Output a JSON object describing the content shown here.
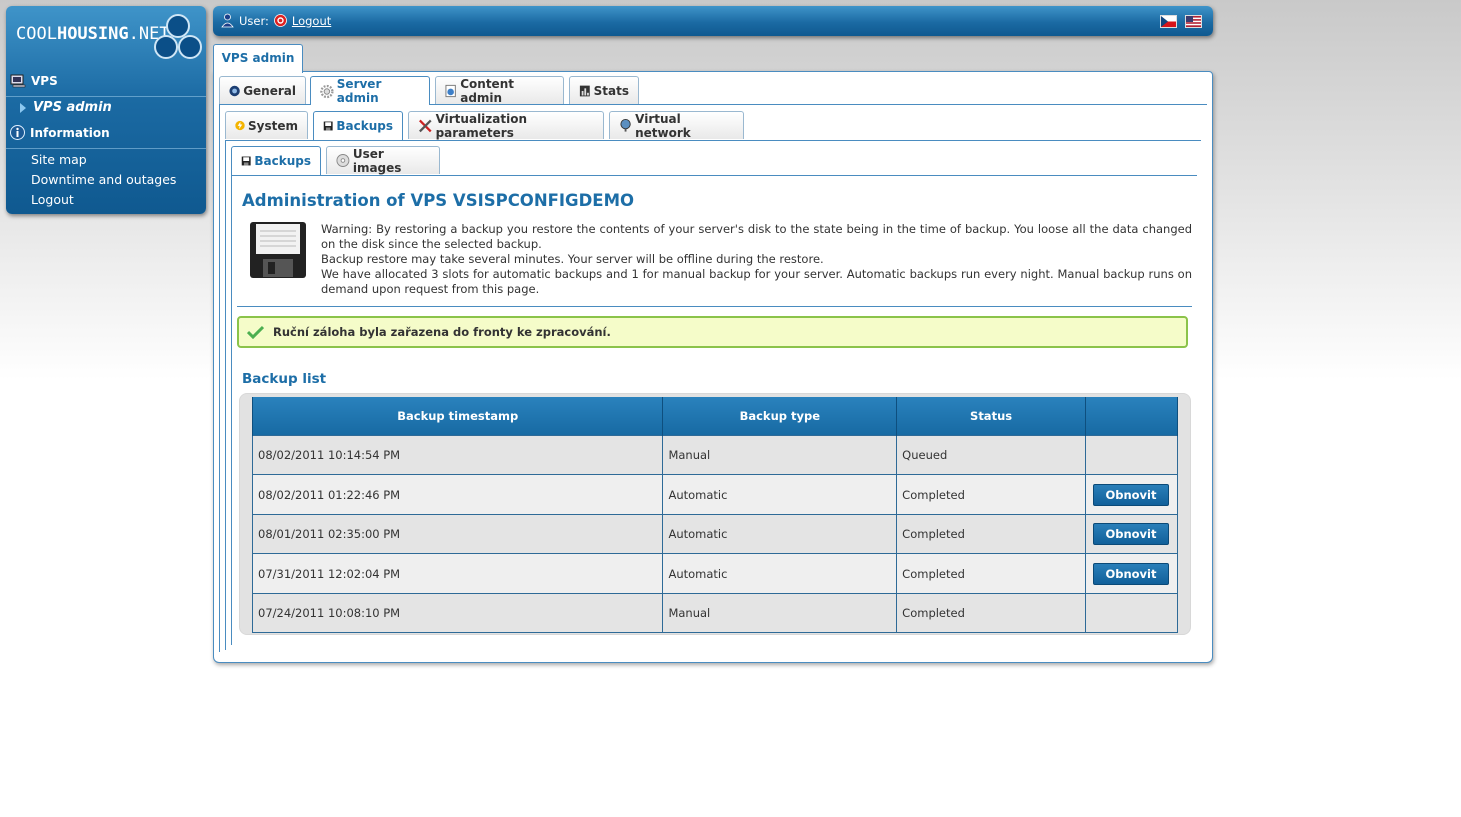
{
  "brand": {
    "logo_light": "COOL",
    "logo_bold": "HOUSING",
    "logo_suffix": ".NET"
  },
  "sidebar": {
    "sections": [
      {
        "label": "VPS",
        "icon": "monitor-icon"
      },
      {
        "label": "VPS admin",
        "icon": "arrow-right-icon",
        "active": true
      },
      {
        "label": "Information",
        "icon": "info-icon"
      }
    ],
    "links": [
      "Site map",
      "Downtime and outages",
      "Logout"
    ]
  },
  "topbar": {
    "user_label": "User:",
    "logout_label": "Logout",
    "languages": [
      "cz",
      "us"
    ]
  },
  "page_tab": "VPS admin",
  "tabs_level1": [
    "General",
    "Server admin",
    "Content admin",
    "Stats"
  ],
  "tabs_level2": [
    "System",
    "Backups",
    "Virtualization parameters",
    "Virtual network"
  ],
  "tabs_level3": [
    "Backups",
    "User images"
  ],
  "content": {
    "title": "Administration of VPS VSISPCONFIGDEMO",
    "warning_1": "Warning: By restoring a backup you restore the contents of your server's disk to the state being in the time of backup. You loose all the data changed on the disk since the selected backup.",
    "warning_2": "Backup restore may take several minutes. Your server will be offline during the restore.",
    "warning_3": "We have allocated 3 slots for automatic backups and 1 for manual backup for your server. Automatic backups run every night. Manual backup runs on demand upon request from this page.",
    "success_message": "Ruční záloha byla zařazena do fronty ke zpracování.",
    "backup_list_title": "Backup list"
  },
  "backup_table": {
    "headers": [
      "Backup timestamp",
      "Backup type",
      "Status",
      ""
    ],
    "restore_label": "Obnovit",
    "rows": [
      {
        "timestamp": "08/02/2011 10:14:54 PM",
        "type": "Manual",
        "status": "Queued",
        "restore": false
      },
      {
        "timestamp": "08/02/2011 01:22:46 PM",
        "type": "Automatic",
        "status": "Completed",
        "restore": true
      },
      {
        "timestamp": "08/01/2011 02:35:00 PM",
        "type": "Automatic",
        "status": "Completed",
        "restore": true
      },
      {
        "timestamp": "07/31/2011 12:02:04 PM",
        "type": "Automatic",
        "status": "Completed",
        "restore": true
      },
      {
        "timestamp": "07/24/2011 10:08:10 PM",
        "type": "Manual",
        "status": "Completed",
        "restore": false
      }
    ]
  },
  "colors": {
    "brand_blue": "#1b6aa3",
    "title_blue": "#1d6ea7",
    "success_bg": "#f5fcc9",
    "success_border": "#8bc34a"
  }
}
